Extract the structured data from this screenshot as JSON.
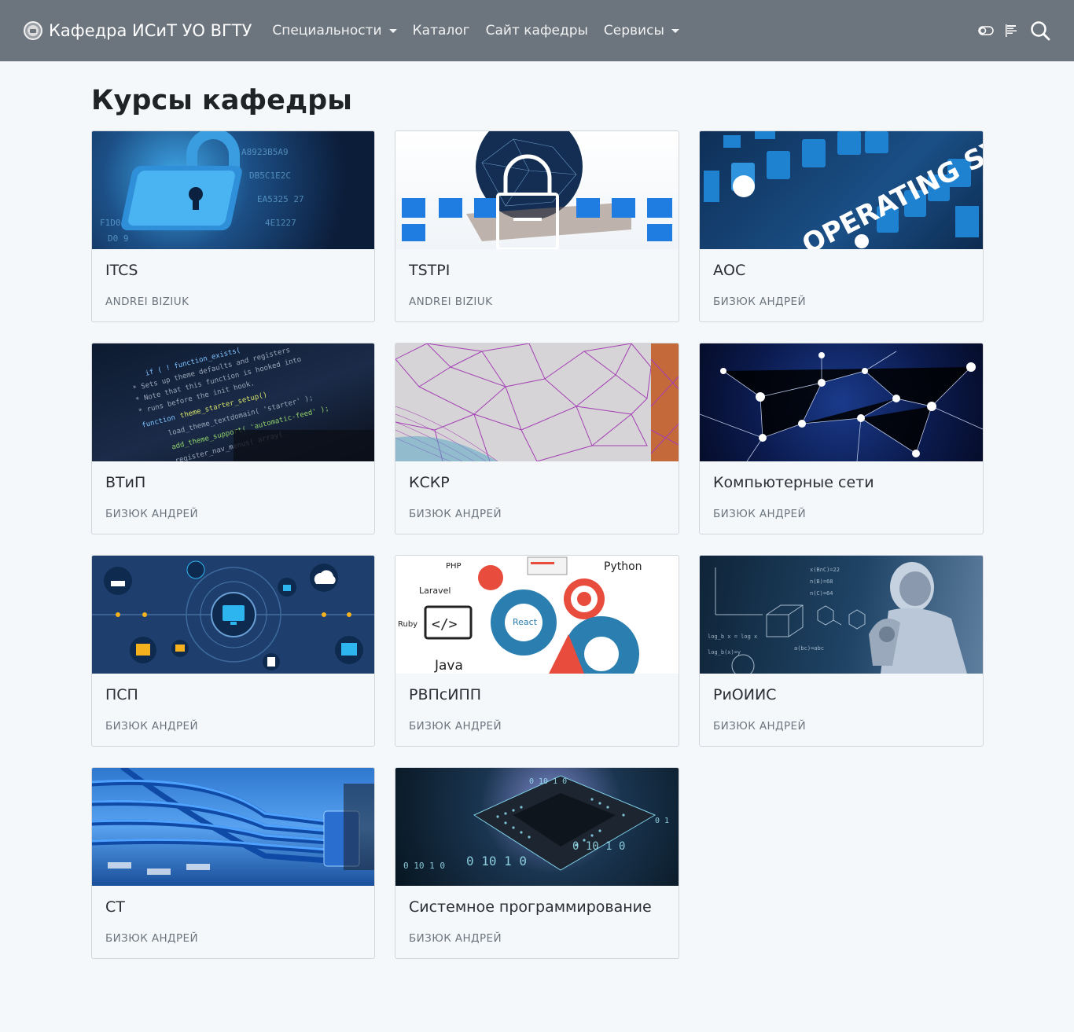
{
  "navbar": {
    "brand": "Кафедра ИСиТ УО ВГТУ",
    "items": [
      {
        "label": "Специальности",
        "dropdown": true
      },
      {
        "label": "Каталог",
        "dropdown": false
      },
      {
        "label": "Сайт кафедры",
        "dropdown": false
      },
      {
        "label": "Сервисы",
        "dropdown": true
      }
    ],
    "icons": [
      "theme-toggle-icon",
      "language-icon",
      "search-icon"
    ]
  },
  "page": {
    "title": "Курсы кафедры"
  },
  "courses": [
    {
      "title": "ITCS",
      "author": "Andrei Biziuk",
      "image": "padlock-data-image"
    },
    {
      "title": "TSTPI",
      "author": "Andrei Biziuk",
      "image": "network-lock-image"
    },
    {
      "title": "АОС",
      "author": "Бизюк Андрей",
      "image": "operating-system-image"
    },
    {
      "title": "ВТиП",
      "author": "Бизюк Андрей",
      "image": "code-screen-image"
    },
    {
      "title": "КСКР",
      "author": "Бизюк Андрей",
      "image": "mesh-image"
    },
    {
      "title": "Компьютерные сети",
      "author": "Бизюк Андрей",
      "image": "network-nodes-image"
    },
    {
      "title": "ПСП",
      "author": "Бизюк Андрей",
      "image": "network-icons-image"
    },
    {
      "title": "РВПсИПП",
      "author": "Бизюк Андрей",
      "image": "programming-gears-image"
    },
    {
      "title": "РиОИИС",
      "author": "Бизюк Андрей",
      "image": "robot-formulas-image"
    },
    {
      "title": "СТ",
      "author": "Бизюк Андрей",
      "image": "network-cables-image"
    },
    {
      "title": "Системное программирование",
      "author": "Бизюк Андрей",
      "image": "microchip-image"
    }
  ],
  "thumb_texts": {
    "os": "OPERATING SYSTEM",
    "php": "PHP",
    "python": "Python",
    "laravel": "Laravel",
    "ruby": "Ruby",
    "java": "Java",
    "react": "React"
  }
}
